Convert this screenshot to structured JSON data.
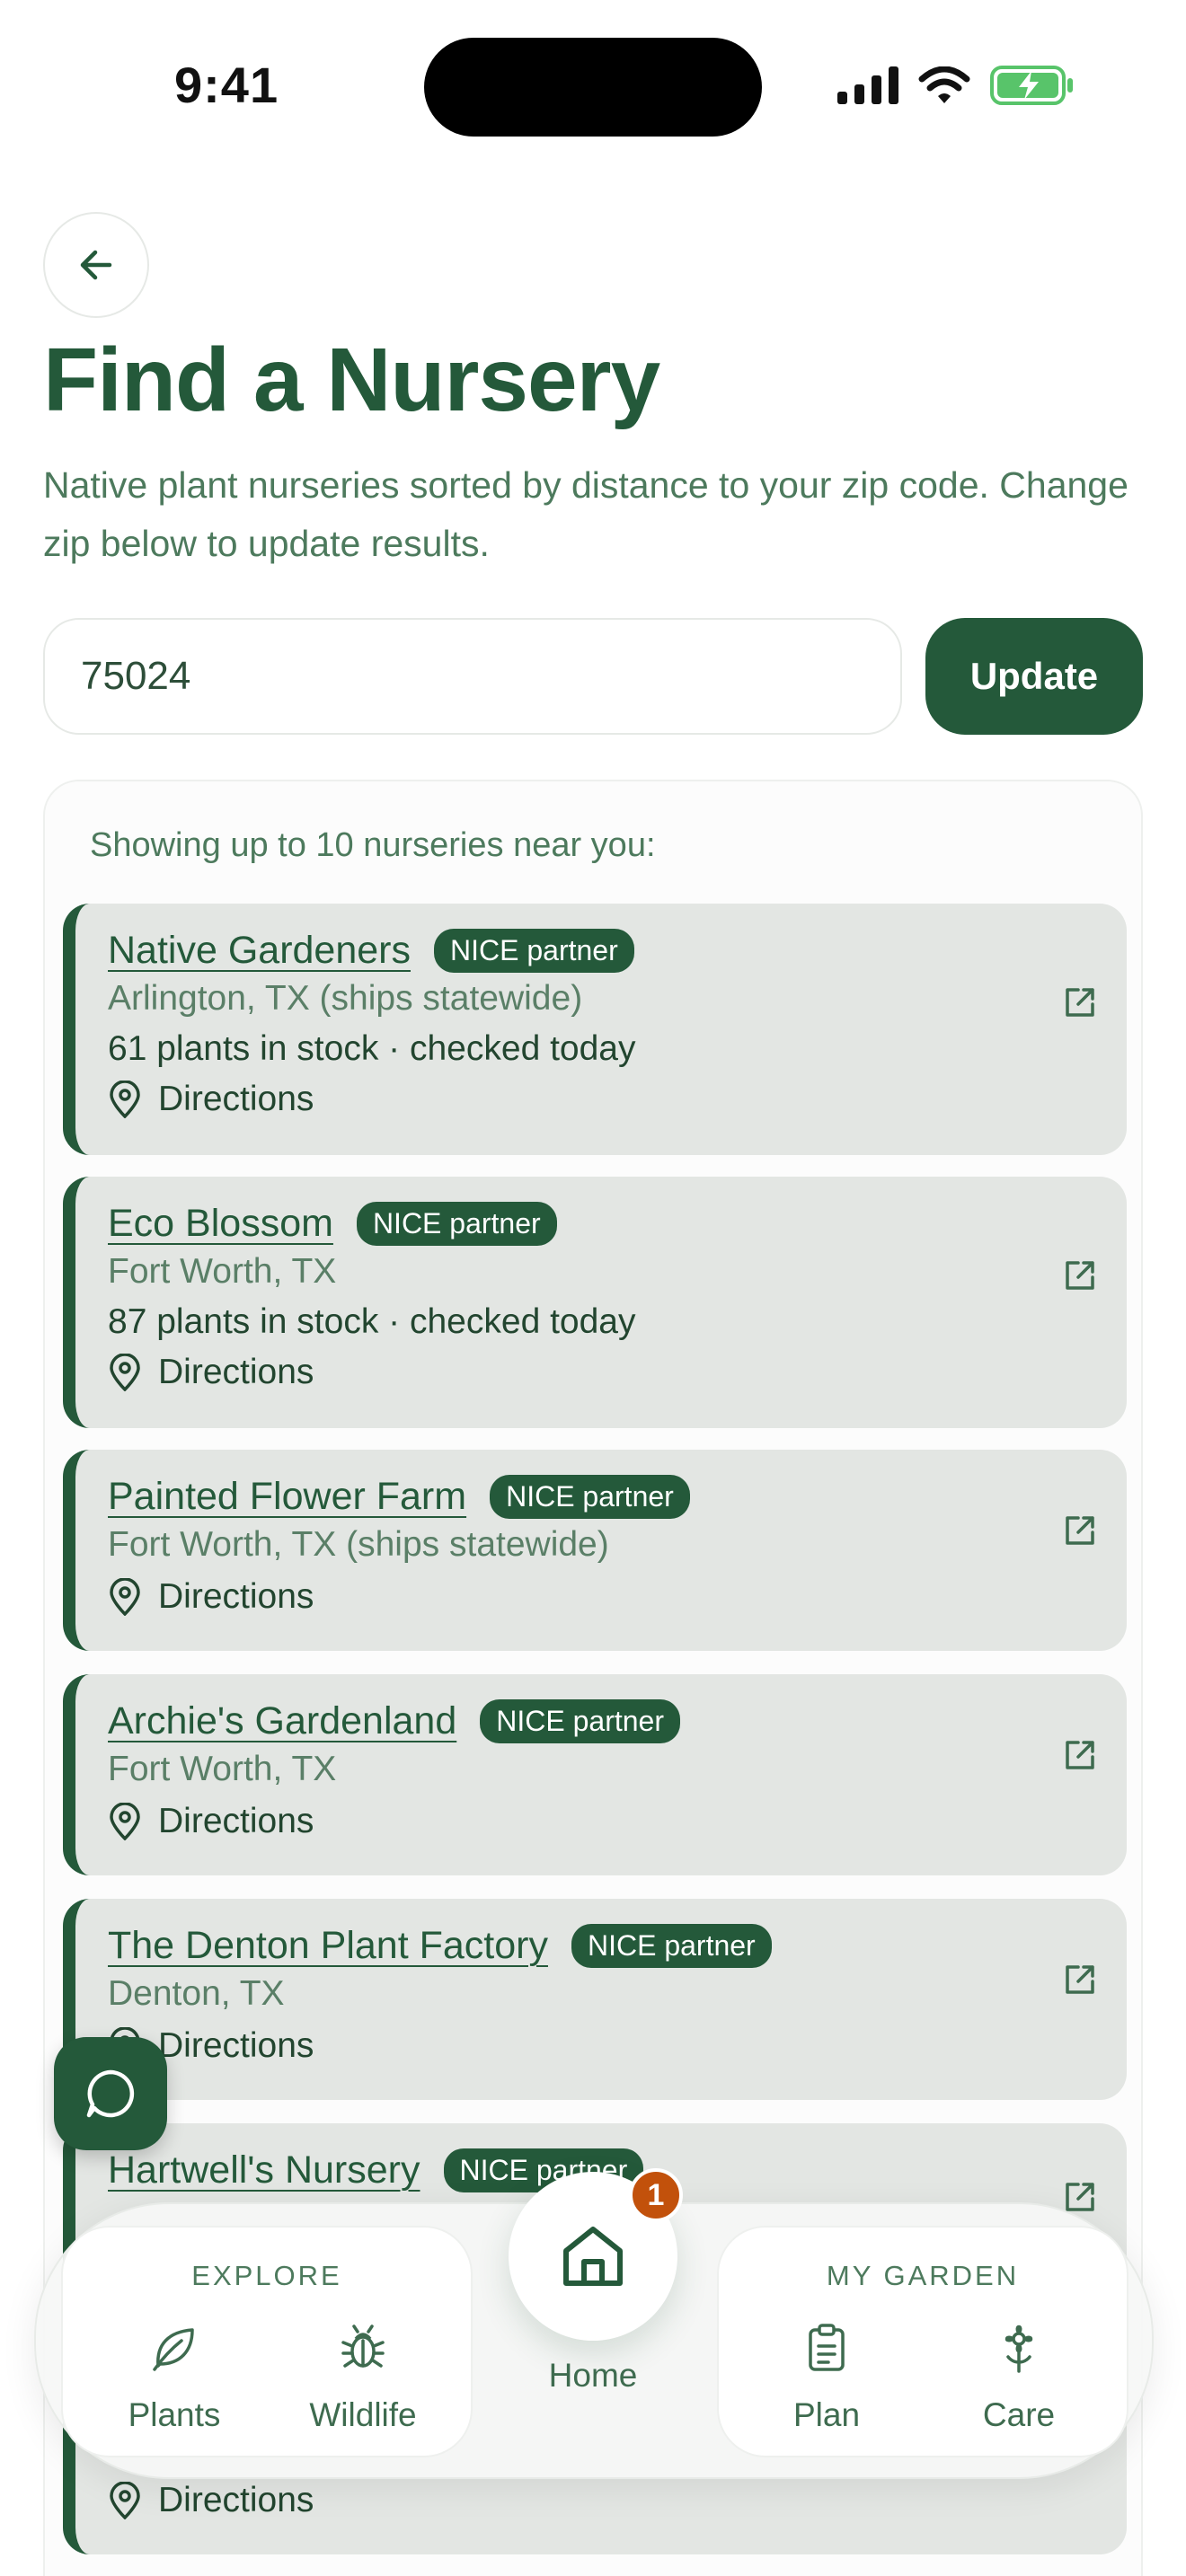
{
  "status_bar": {
    "time": "9:41"
  },
  "header": {
    "title": "Find a Nursery",
    "subtitle": "Native plant nurseries sorted by distance to your zip code. Change zip below to update results."
  },
  "search": {
    "zip_value": "75024",
    "update_label": "Update"
  },
  "results": {
    "heading": "Showing up to 10 nurseries near you:",
    "directions_label": "Directions",
    "nurseries": [
      {
        "name": "Native Gardeners",
        "badge": "NICE partner",
        "location": "Arlington, TX (ships statewide)",
        "stock": "61 plants in stock · checked today"
      },
      {
        "name": "Eco Blossom",
        "badge": "NICE partner",
        "location": "Fort Worth, TX",
        "stock": "87 plants in stock · checked today"
      },
      {
        "name": "Painted Flower Farm",
        "badge": "NICE partner",
        "location": "Fort Worth, TX (ships statewide)"
      },
      {
        "name": "Archie's Gardenland",
        "badge": "NICE partner",
        "location": "Fort Worth, TX"
      },
      {
        "name": "The Denton Plant Factory",
        "badge": "NICE partner",
        "location": "Denton, TX"
      },
      {
        "name": "Hartwell's Nursery",
        "badge": "NICE partner"
      }
    ]
  },
  "tab_bar": {
    "explore_label": "EXPLORE",
    "my_garden_label": "MY GARDEN",
    "plants": "Plants",
    "wildlife": "Wildlife",
    "home": "Home",
    "home_badge": "1",
    "plan": "Plan",
    "care": "Care"
  },
  "icons": {
    "back": "arrow-left-icon",
    "external": "external-link-icon",
    "pin": "map-pin-icon",
    "chat": "chat-bubble-icon",
    "plants": "leaf-icon",
    "wildlife": "bug-icon",
    "home": "house-icon",
    "plan": "clipboard-icon",
    "care": "flower-icon"
  },
  "colors": {
    "primary": "#24593a",
    "card_bg": "#e3e6e3",
    "badge_alert": "#c2510b"
  }
}
